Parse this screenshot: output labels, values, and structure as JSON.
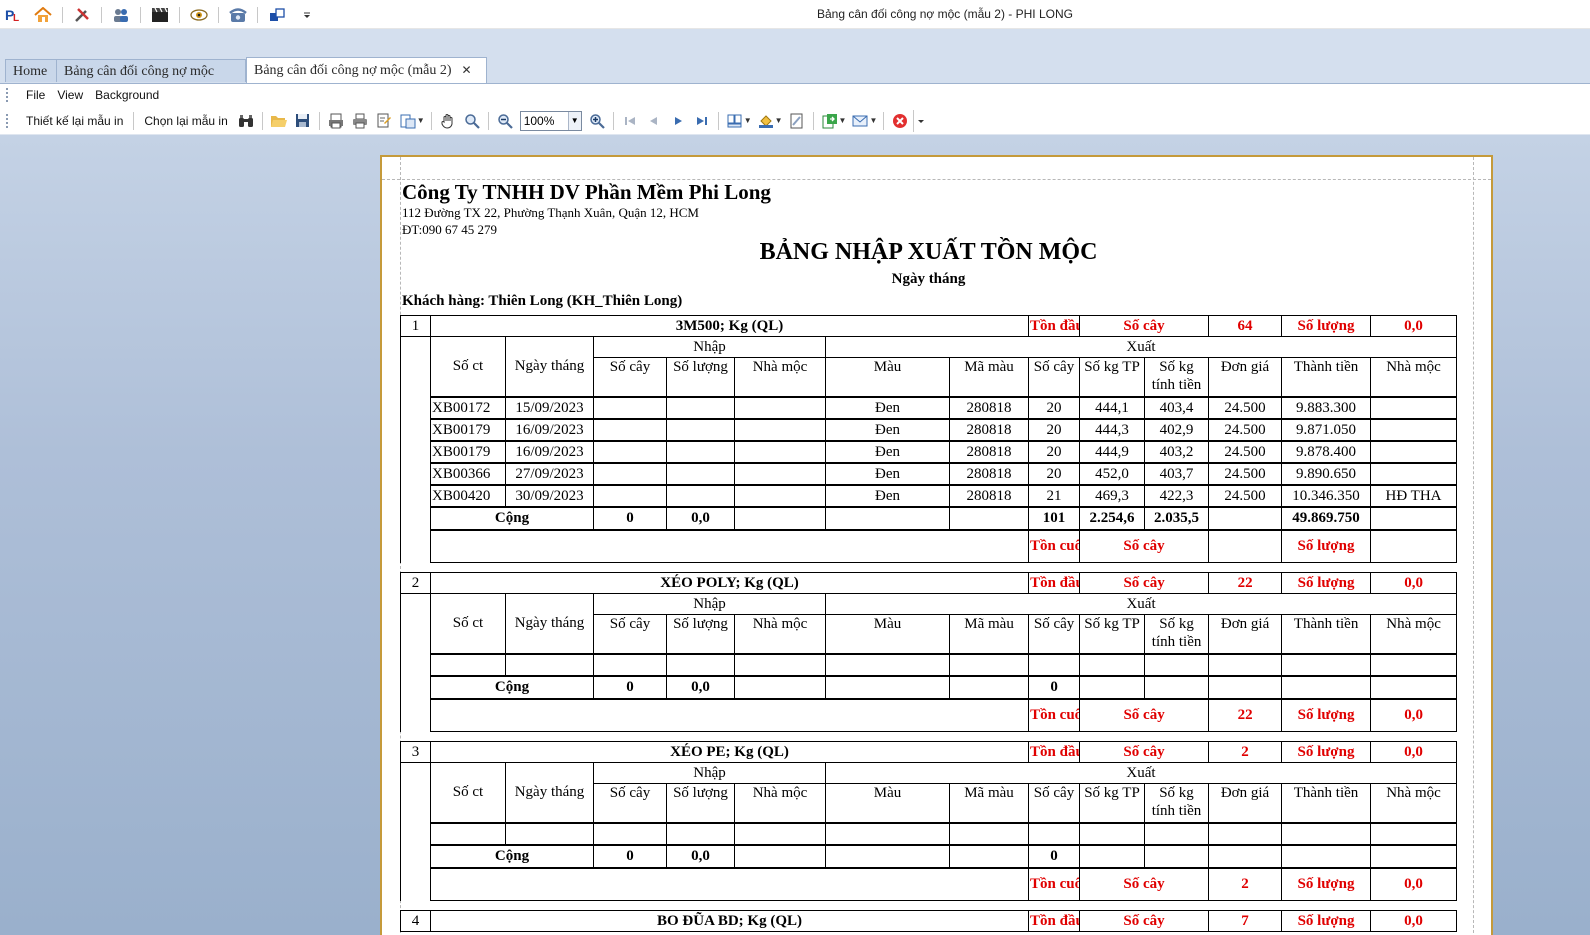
{
  "window": {
    "title": "Bảng cân đối công nợ mộc (mẫu 2) - PHI LONG",
    "qat_icons": [
      "app-logo-icon",
      "home-icon",
      "tools-icon",
      "users-icon",
      "clapper-icon",
      "eye-icon",
      "phone-icon",
      "window-switch-icon",
      "customize-dropdown-icon"
    ]
  },
  "tabs": [
    {
      "label": "Home"
    },
    {
      "label": "Bảng cân đối công nợ mộc"
    },
    {
      "label": "Bảng cân đối công nợ mộc (mẫu 2)",
      "close": "✕"
    }
  ],
  "menu": [
    "File",
    "View",
    "Background"
  ],
  "toolbar": {
    "redesign_label": "Thiết kế lại mẫu in",
    "reselect_label": "Chọn lại mẫu in",
    "zoom_value": "100%"
  },
  "report": {
    "company_name": "Công Ty TNHH DV Phần Mềm Phi Long",
    "address": "112 Đường TX 22, Phường Thạnh Xuân, Quận 12, HCM",
    "phone": "ĐT:090 67 45 279",
    "title": "BẢNG NHẬP XUẤT TỒN MỘC",
    "subtitle": "Ngày tháng",
    "customer": "Khách hàng: Thiên Long (KH_Thiên Long)",
    "labels": {
      "opening": "Tồn đầu",
      "closing": "Tồn cuối",
      "trees": "Số cây",
      "quantity": "Số lượng",
      "import_group": "Nhập",
      "export_group": "Xuất",
      "total": "Cộng"
    },
    "columns": {
      "doc_no": "Số ct",
      "date": "Ngày tháng",
      "in_trees": "Số cây",
      "in_qty": "Số lượng",
      "in_supplier": "Nhà mộc",
      "color": "Màu",
      "color_code": "Mã màu",
      "out_trees": "Số cây",
      "kg_tp": "Số kg TP",
      "kg_charge_1": "Số kg",
      "kg_charge_2": "tính tiền",
      "unit_price": "Đơn giá",
      "amount": "Thành tiền",
      "out_supplier": "Nhà mộc"
    },
    "groups": [
      {
        "index": "1",
        "name": "3M500; Kg (QL)",
        "open_trees": "64",
        "open_qty": "0,0",
        "rows": [
          {
            "doc": "XB00172",
            "date": "15/09/2023",
            "in_trees": "",
            "in_qty": "",
            "in_sup": "",
            "color": "Đen",
            "code": "280818",
            "trees": "20",
            "kg_tp": "444,1",
            "kg_charge": "403,4",
            "price": "24.500",
            "amount": "9.883.300",
            "sup": ""
          },
          {
            "doc": "XB00179",
            "date": "16/09/2023",
            "in_trees": "",
            "in_qty": "",
            "in_sup": "",
            "color": "Đen",
            "code": "280818",
            "trees": "20",
            "kg_tp": "444,3",
            "kg_charge": "402,9",
            "price": "24.500",
            "amount": "9.871.050",
            "sup": ""
          },
          {
            "doc": "XB00179",
            "date": "16/09/2023",
            "in_trees": "",
            "in_qty": "",
            "in_sup": "",
            "color": "Đen",
            "code": "280818",
            "trees": "20",
            "kg_tp": "444,9",
            "kg_charge": "403,2",
            "price": "24.500",
            "amount": "9.878.400",
            "sup": ""
          },
          {
            "doc": "XB00366",
            "date": "27/09/2023",
            "in_trees": "",
            "in_qty": "",
            "in_sup": "",
            "color": "Đen",
            "code": "280818",
            "trees": "20",
            "kg_tp": "452,0",
            "kg_charge": "403,7",
            "price": "24.500",
            "amount": "9.890.650",
            "sup": ""
          },
          {
            "doc": "XB00420",
            "date": "30/09/2023",
            "in_trees": "",
            "in_qty": "",
            "in_sup": "",
            "color": "Đen",
            "code": "280818",
            "trees": "21",
            "kg_tp": "469,3",
            "kg_charge": "422,3",
            "price": "24.500",
            "amount": "10.346.350",
            "sup": "HĐ THA"
          }
        ],
        "total": {
          "in_trees": "0",
          "in_qty": "0,0",
          "trees": "101",
          "kg_tp": "2.254,6",
          "kg_charge": "2.035,5",
          "amount": "49.869.750"
        },
        "close_trees": "",
        "close_qty": ""
      },
      {
        "index": "2",
        "name": "XÉO POLY; Kg (QL)",
        "open_trees": "22",
        "open_qty": "0,0",
        "rows": [
          {
            "doc": "",
            "date": "",
            "in_trees": "",
            "in_qty": "",
            "in_sup": "",
            "color": "",
            "code": "",
            "trees": "",
            "kg_tp": "",
            "kg_charge": "",
            "price": "",
            "amount": "",
            "sup": ""
          }
        ],
        "total": {
          "in_trees": "0",
          "in_qty": "0,0",
          "trees": "0",
          "kg_tp": "",
          "kg_charge": "",
          "amount": ""
        },
        "close_trees": "22",
        "close_qty": "0,0"
      },
      {
        "index": "3",
        "name": "XÉO PE; Kg (QL)",
        "open_trees": "2",
        "open_qty": "0,0",
        "rows": [
          {
            "doc": "",
            "date": "",
            "in_trees": "",
            "in_qty": "",
            "in_sup": "",
            "color": "",
            "code": "",
            "trees": "",
            "kg_tp": "",
            "kg_charge": "",
            "price": "",
            "amount": "",
            "sup": ""
          }
        ],
        "total": {
          "in_trees": "0",
          "in_qty": "0,0",
          "trees": "0",
          "kg_tp": "",
          "kg_charge": "",
          "amount": ""
        },
        "close_trees": "2",
        "close_qty": "0,0"
      },
      {
        "index": "4",
        "name": "BO ĐŨA BD; Kg (QL)",
        "open_trees": "7",
        "open_qty": "0,0",
        "rows": [],
        "total": null,
        "close_trees": "",
        "close_qty": ""
      }
    ]
  }
}
